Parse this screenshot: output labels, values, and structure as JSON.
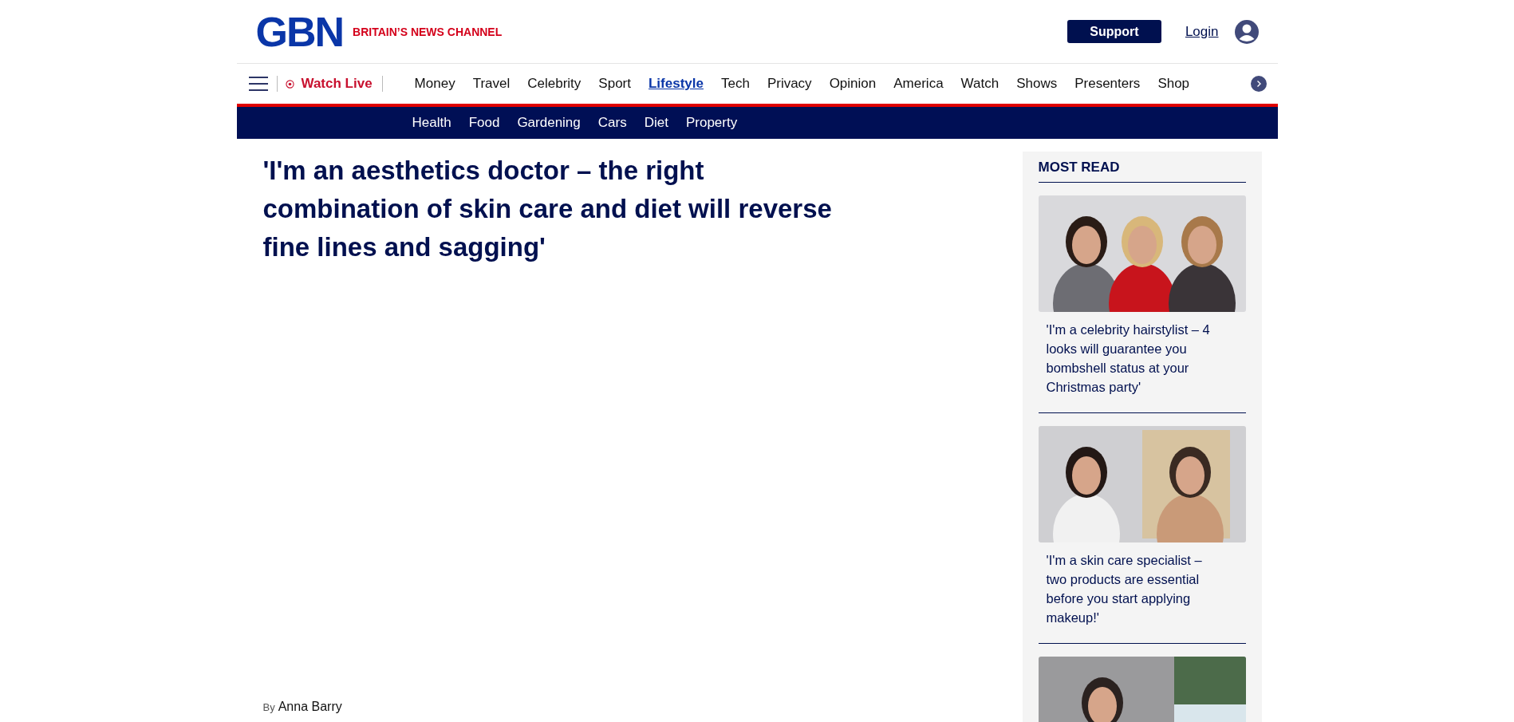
{
  "header": {
    "logo": "GBN",
    "tagline": "BRITAIN’S NEWS CHANNEL",
    "support": "Support",
    "login": "Login"
  },
  "nav": {
    "watch_live": "Watch Live",
    "items": [
      {
        "label": "Money",
        "selected": false
      },
      {
        "label": "Travel",
        "selected": false
      },
      {
        "label": "Celebrity",
        "selected": false
      },
      {
        "label": "Sport",
        "selected": false
      },
      {
        "label": "Lifestyle",
        "selected": true
      },
      {
        "label": "Tech",
        "selected": false
      },
      {
        "label": "Privacy",
        "selected": false
      },
      {
        "label": "Opinion",
        "selected": false
      },
      {
        "label": "America",
        "selected": false
      },
      {
        "label": "Watch",
        "selected": false
      },
      {
        "label": "Shows",
        "selected": false
      },
      {
        "label": "Presenters",
        "selected": false
      },
      {
        "label": "Shop",
        "selected": false
      }
    ]
  },
  "subnav": [
    "Health",
    "Food",
    "Gardening",
    "Cars",
    "Diet",
    "Property"
  ],
  "article": {
    "headline": "'I'm an aesthetics doctor – the right combination of skin care and diet will reverse fine lines and sagging'",
    "byline_prefix": "By",
    "author": "Anna Barry"
  },
  "most_read": {
    "title": "MOST READ",
    "items": [
      {
        "image": {
          "kind": "picture"
        },
        "title": "'I'm a celebrity hairstylist – 4 looks will guarantee you bombshell status at your Christmas party'"
      },
      {
        "image": {
          "kind": "picture"
        },
        "title": "'I'm a skin care specialist – two products are essential before you start applying makeup!'"
      },
      {
        "image": {
          "kind": "picture"
        }
      }
    ]
  }
}
